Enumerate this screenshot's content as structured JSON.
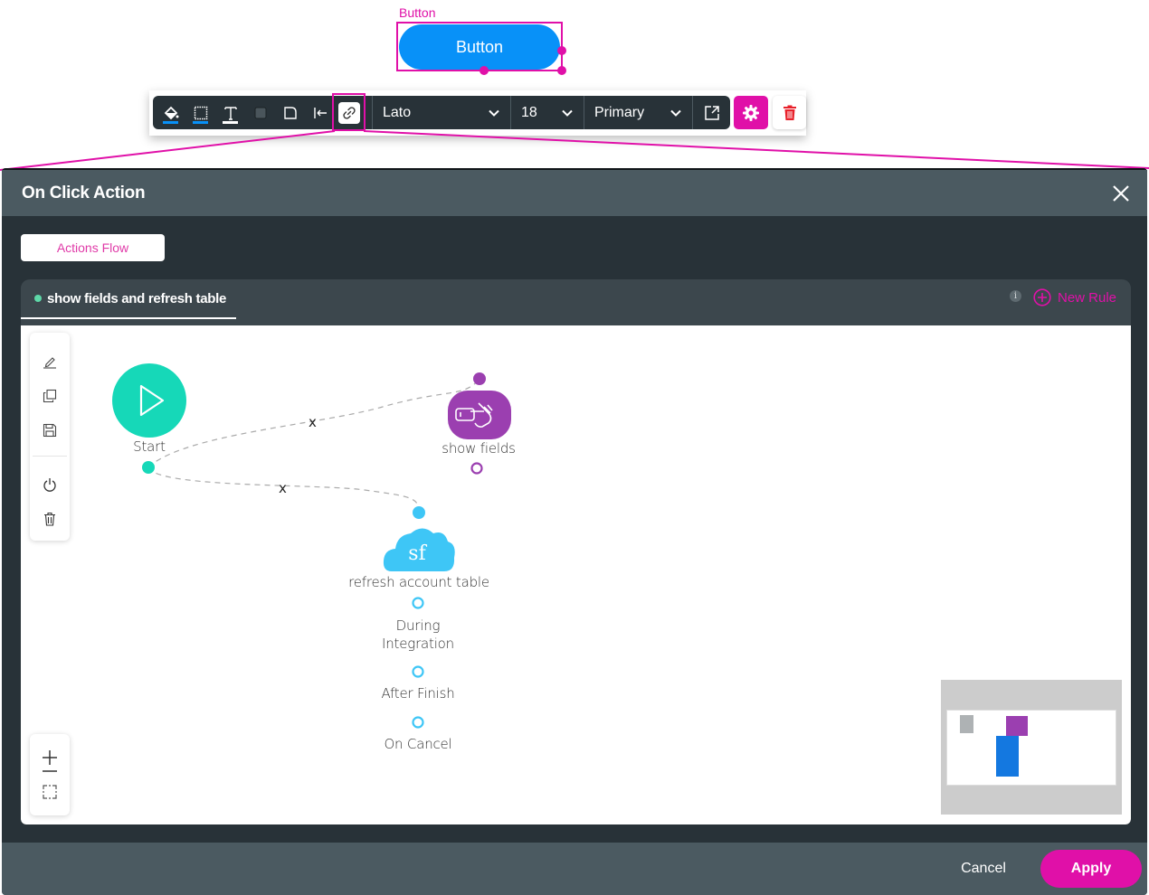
{
  "canvas_element": {
    "selection_label": "Button",
    "button_text": "Button"
  },
  "toolbar": {
    "icons": [
      "fill-color-icon",
      "border-color-icon",
      "text-color-icon",
      "shadow-icon",
      "corner-radius-icon",
      "align-left-icon",
      "link-icon"
    ],
    "font_family": "Lato",
    "font_size": "18",
    "style": "Primary",
    "fill_underline_color": "#0891f8",
    "border_underline_color": "#0891f8",
    "text_underline_color": "#ffffff"
  },
  "modal": {
    "title": "On Click Action",
    "tabs": [
      {
        "label": "Actions Flow",
        "active": true
      }
    ],
    "rule": {
      "name": "show fields and refresh table",
      "status_color": "#5ed8a8",
      "info": "i",
      "new_rule_label": "New Rule"
    },
    "flow": {
      "nodes": [
        {
          "id": "start",
          "label": "Start",
          "color": "#16d8b8",
          "icon": "play-icon"
        },
        {
          "id": "show-fields",
          "label": "show fields",
          "color": "#9b3fb0",
          "icon": "hand-tap-icon"
        },
        {
          "id": "refresh",
          "label": "refresh account table",
          "color": "#3ec6f6",
          "icon": "salesforce-cloud-icon",
          "icon_text": "sf",
          "outputs": [
            "During Integration",
            "After Finish",
            "On Cancel"
          ]
        }
      ],
      "edges": [
        {
          "from": "start",
          "to": "show-fields",
          "label": "x"
        },
        {
          "from": "start",
          "to": "refresh",
          "label": "x"
        }
      ],
      "side_tools": [
        "edit-icon",
        "duplicate-icon",
        "save-icon",
        "power-icon",
        "trash-icon"
      ],
      "zoom_tools": [
        "zoom-in-icon",
        "zoom-out-icon",
        "fit-screen-icon"
      ]
    },
    "footer": {
      "cancel_label": "Cancel",
      "apply_label": "Apply"
    }
  },
  "colors": {
    "accent": "#e010a8",
    "primary_button": "#0891f8",
    "modal_header": "#4b5a61",
    "modal_body": "#283238"
  }
}
